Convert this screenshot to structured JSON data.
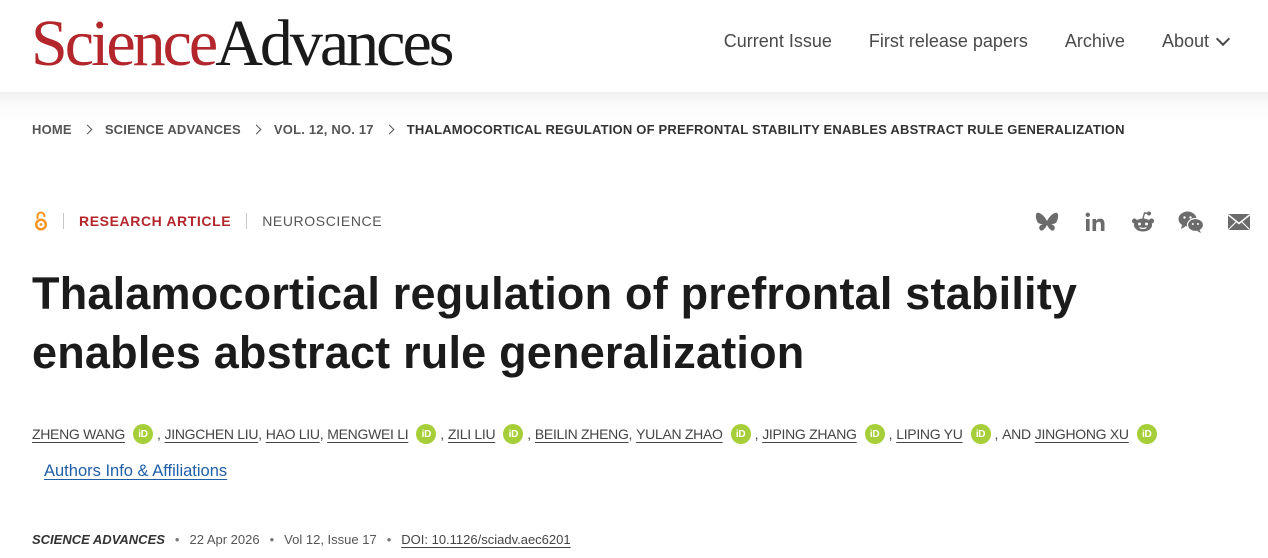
{
  "header": {
    "logo_science": "Science",
    "logo_advances": "Advances",
    "nav": [
      "Current Issue",
      "First release papers",
      "Archive",
      "About"
    ]
  },
  "breadcrumb": [
    "HOME",
    "SCIENCE ADVANCES",
    "VOL. 12, NO. 17",
    "THALAMOCORTICAL REGULATION OF PREFRONTAL STABILITY ENABLES ABSTRACT RULE GENERALIZATION"
  ],
  "article": {
    "type": "RESEARCH ARTICLE",
    "subject": "NEUROSCIENCE",
    "title": "Thalamocortical regulation of prefrontal stability enables abstract rule generalization",
    "authors": [
      {
        "name": "ZHENG WANG",
        "orcid": true
      },
      {
        "name": "JINGCHEN LIU",
        "orcid": false
      },
      {
        "name": "HAO LIU",
        "orcid": false
      },
      {
        "name": "MENGWEI LI",
        "orcid": true
      },
      {
        "name": "ZILI LIU",
        "orcid": true
      },
      {
        "name": "BEILIN ZHENG",
        "orcid": false
      },
      {
        "name": "YULAN ZHAO",
        "orcid": true
      },
      {
        "name": "JIPING ZHANG",
        "orcid": true
      },
      {
        "name": "LIPING YU",
        "orcid": true
      },
      {
        "name": "JINGHONG XU",
        "orcid": true
      }
    ],
    "and_word": "AND",
    "orcid_label": "iD",
    "affiliations_link": "Authors Info & Affiliations",
    "citation": {
      "journal": "SCIENCE ADVANCES",
      "date": "22 Apr 2026",
      "volume": "Vol 12, Issue 17",
      "doi": "DOI: 10.1126/sciadv.aec6201"
    }
  },
  "share_icons": [
    "bluesky-icon",
    "linkedin-icon",
    "reddit-icon",
    "wechat-icon",
    "email-icon"
  ],
  "colors": {
    "brand_red": "#b3262c",
    "orcid_green": "#a6ce39",
    "link_blue": "#1f5fa8",
    "open_access_orange": "#f7941d"
  }
}
